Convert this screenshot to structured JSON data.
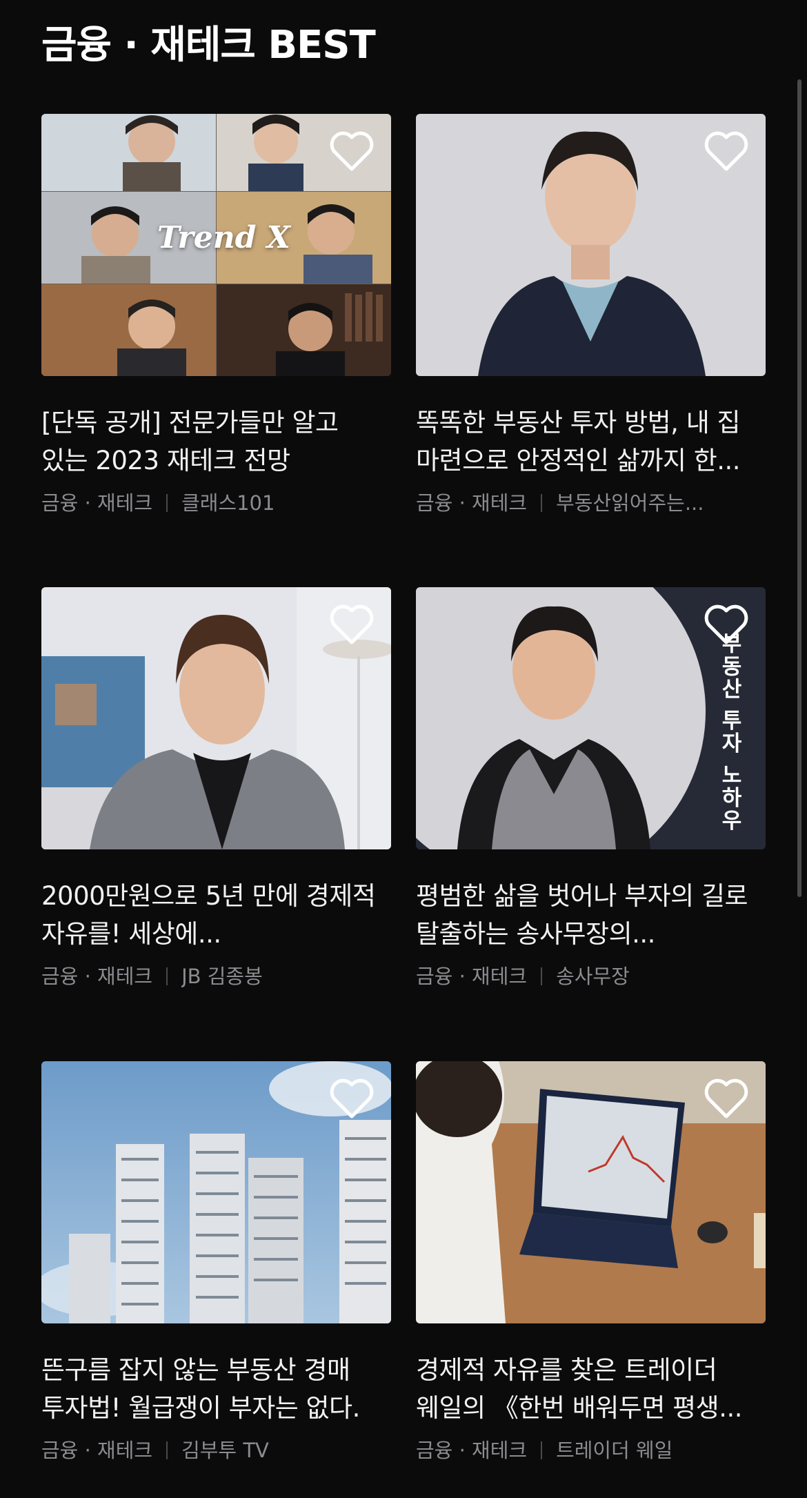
{
  "section": {
    "title": "금융 · 재테크 BEST"
  },
  "cards": [
    {
      "title": "[단독 공개] 전문가들만 알고 있는 2023 재테크 전망",
      "category": "금융 · 재테크",
      "creator": "클래스101",
      "overlay_text": "Trend X",
      "image": "grid-of-six-experts"
    },
    {
      "title": "똑똑한 부동산 투자 방법, 내 집 마련으로 안정적인 삶까지 한...",
      "category": "금융 · 재테크",
      "creator": "부동산읽어주는...",
      "image": "man-in-navy-blazer-portrait"
    },
    {
      "title": "2000만원으로 5년 만에 경제적 자유를! 세상에...",
      "category": "금융 · 재테크",
      "creator": "JB 김종봉",
      "image": "man-in-plaid-jacket-interview"
    },
    {
      "title": "평범한 삶을 벗어나 부자의 길로 탈출하는 송사무장의...",
      "category": "금융 · 재테크",
      "creator": "송사무장",
      "overlay_text": "부동산 투자 노하우",
      "image": "smiling-man-in-vest-circle"
    },
    {
      "title": "뜬구름 잡지 않는 부동산 경매 투자법! 월급쟁이 부자는 없다.",
      "category": "금융 · 재테크",
      "creator": "김부투 TV",
      "image": "apartment-towers-blue-sky"
    },
    {
      "title": "경제적 자유를 찾은 트레이더 웨일의 《한번 배워두면 평생...",
      "category": "금융 · 재테크",
      "creator": "트레이더 웨일",
      "image": "trader-laptop-stock-chart"
    }
  ],
  "icons": {
    "favorite": "heart-outline-icon"
  },
  "colors": {
    "background": "#0b0b0c",
    "title_text": "#f2f2f2",
    "meta_text": "#8c8c90"
  }
}
